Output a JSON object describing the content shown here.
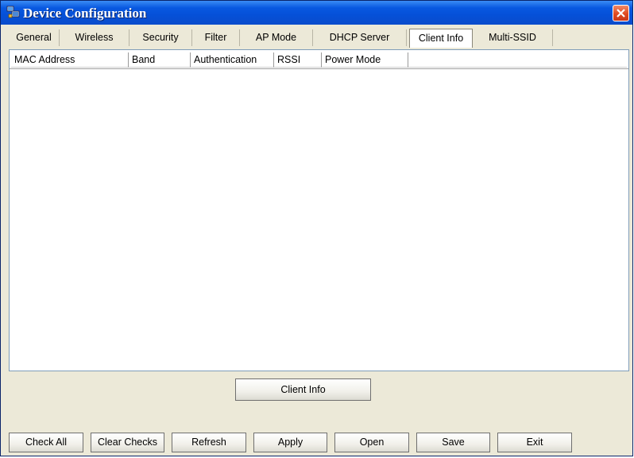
{
  "window": {
    "title": "Device Configuration"
  },
  "tabs": [
    {
      "label": "General"
    },
    {
      "label": "Wireless"
    },
    {
      "label": "Security"
    },
    {
      "label": "Filter"
    },
    {
      "label": "AP Mode"
    },
    {
      "label": "DHCP Server"
    },
    {
      "label": "Client Info",
      "active": true
    },
    {
      "label": "Multi-SSID"
    }
  ],
  "client_list": {
    "columns": [
      "MAC Address",
      "Band",
      "Authentication",
      "RSSI",
      "Power Mode"
    ],
    "rows": []
  },
  "client_info_button": "Client Info",
  "footer_buttons": [
    "Check All",
    "Clear Checks",
    "Refresh",
    "Apply",
    "Open",
    "Save",
    "Exit"
  ],
  "colors": {
    "titlebar": "#0550d8",
    "window_face": "#ece9d8",
    "close_button": "#e04a20"
  },
  "icons": {
    "title": "network-computers-icon",
    "close": "close-icon"
  }
}
